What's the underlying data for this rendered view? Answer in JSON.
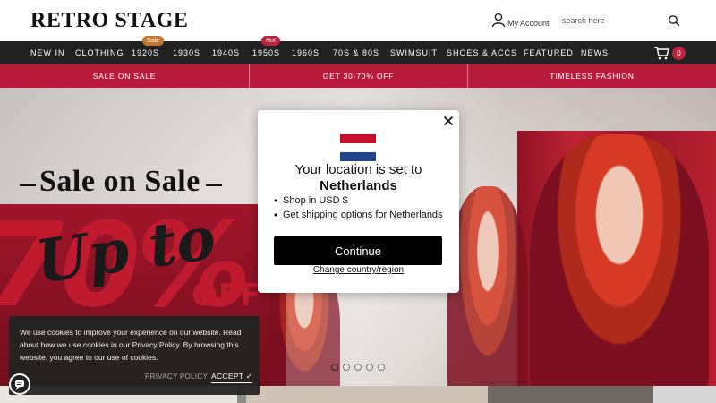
{
  "header": {
    "logo": "RETRO STAGE",
    "account_label": "My Account",
    "search_placeholder": "search here"
  },
  "nav": {
    "items": [
      {
        "label": "NEW IN"
      },
      {
        "label": "CLOTHING"
      },
      {
        "label": "1920S",
        "badge": "Sale"
      },
      {
        "label": "1930S"
      },
      {
        "label": "1940S"
      },
      {
        "label": "1950S",
        "badge": "Hot"
      },
      {
        "label": "1960S"
      },
      {
        "label": "70S & 80S"
      },
      {
        "label": "SWIMSUIT"
      },
      {
        "label": "SHOES & ACCS"
      },
      {
        "label": "FEATURED"
      },
      {
        "label": "NEWS"
      }
    ],
    "cart_count": "0",
    "badge_colors": {
      "sale": "#c5762a",
      "hot": "#c0213e"
    }
  },
  "promo": {
    "items": [
      "SALE ON SALE",
      "GET 30-70% OFF",
      "TIMELESS FASHION"
    ],
    "color": "#b91b3b"
  },
  "hero": {
    "title": "Sale on Sale",
    "big_number": "70%",
    "script_text": "Up to",
    "off_text": "OFF",
    "slides": 5,
    "active_slide": 1
  },
  "modal": {
    "line1": "Your location is set to",
    "country": "Netherlands",
    "bullet1": "Shop in USD $",
    "bullet2": "Get shipping options for Netherlands",
    "button": "Continue",
    "link": "Change country/region",
    "flag_colors": [
      "#c8102e",
      "#ffffff",
      "#21468b"
    ]
  },
  "cookie": {
    "text": "We use cookies to improve your experience on our website. Read about how we use cookies in our Privacy Policy. By browsing this website, you agree to our use of cookies.",
    "policy_label": "PRIVACY POLICY",
    "accept_label": "ACCEPT ✓"
  }
}
